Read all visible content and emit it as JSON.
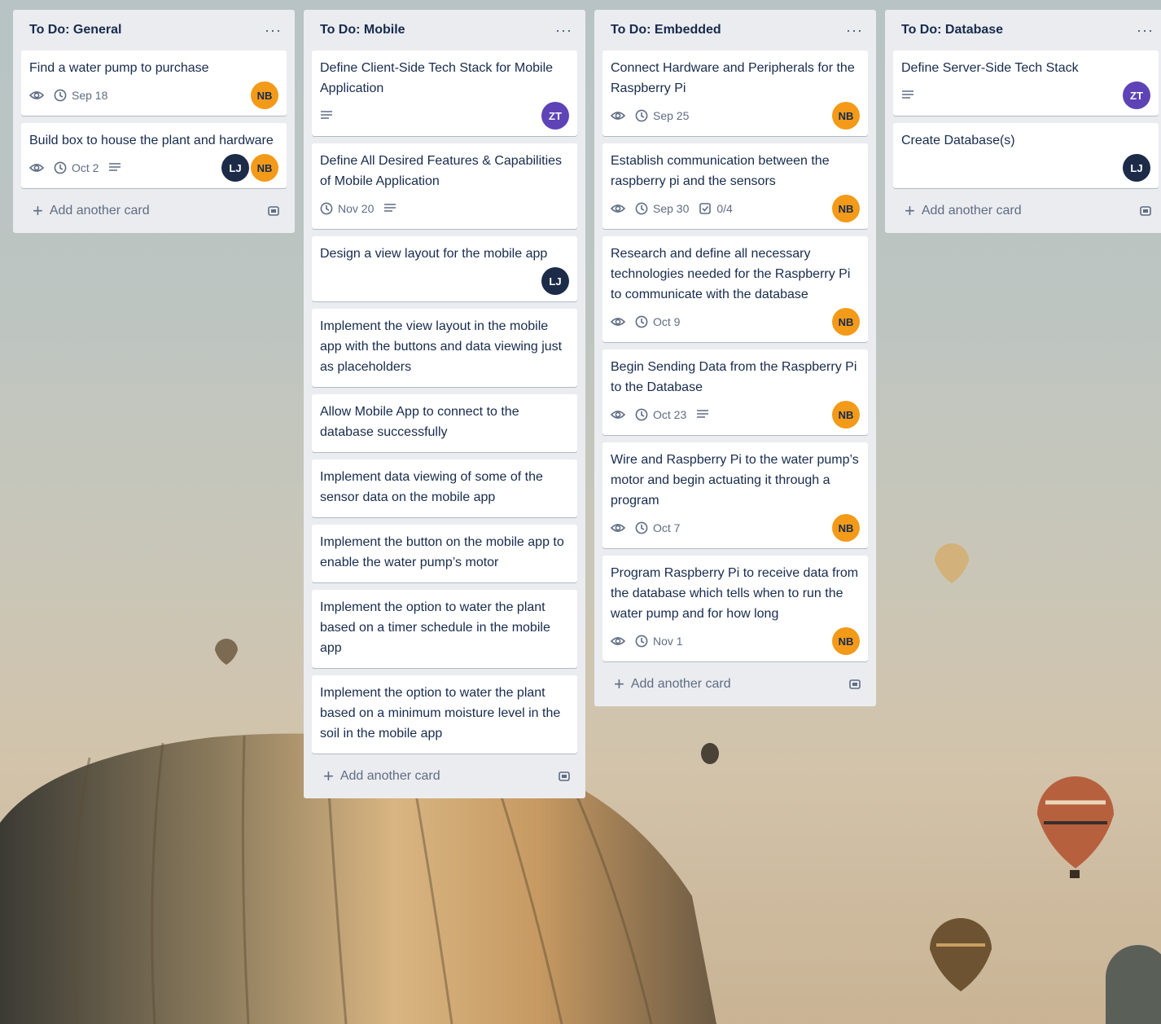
{
  "board": {
    "lists": [
      {
        "title": "To Do: General",
        "menu": "···",
        "add_label": "Add another card",
        "cards": [
          {
            "title": "Find a water pump to purchase",
            "watch": true,
            "due": "Sep 18",
            "desc": false,
            "checklist": "",
            "members": [
              "NB"
            ]
          },
          {
            "title": "Build box to house the plant and hardware",
            "watch": true,
            "due": "Oct 2",
            "desc": true,
            "checklist": "",
            "members": [
              "LJ",
              "NB"
            ]
          }
        ]
      },
      {
        "title": "To Do: Mobile",
        "menu": "···",
        "add_label": "Add another card",
        "cards": [
          {
            "title": "Define Client-Side Tech Stack for Mobile Application",
            "watch": false,
            "due": "",
            "desc": true,
            "checklist": "",
            "members": [
              "ZT"
            ]
          },
          {
            "title": "Define All Desired Features & Capabilities of Mobile Application",
            "watch": false,
            "due": "Nov 20",
            "desc": true,
            "checklist": "",
            "members": []
          },
          {
            "title": "Design a view layout for the mobile app",
            "watch": false,
            "due": "",
            "desc": false,
            "checklist": "",
            "members": [
              "LJ"
            ]
          },
          {
            "title": "Implement the view layout in the mobile app with the buttons and data viewing just as placeholders",
            "watch": false,
            "due": "",
            "desc": false,
            "checklist": "",
            "members": []
          },
          {
            "title": "Allow Mobile App to connect to the database successfully",
            "watch": false,
            "due": "",
            "desc": false,
            "checklist": "",
            "members": []
          },
          {
            "title": "Implement data viewing of some of the sensor data on the mobile app",
            "watch": false,
            "due": "",
            "desc": false,
            "checklist": "",
            "members": []
          },
          {
            "title": "Implement the button on the mobile app to enable the water pump’s motor",
            "watch": false,
            "due": "",
            "desc": false,
            "checklist": "",
            "members": []
          },
          {
            "title": "Implement the option to water the plant based on a timer schedule in the mobile app",
            "watch": false,
            "due": "",
            "desc": false,
            "checklist": "",
            "members": []
          },
          {
            "title": "Implement the option to water the plant based on a minimum moisture level in the soil in the mobile app",
            "watch": false,
            "due": "",
            "desc": false,
            "checklist": "",
            "members": []
          }
        ]
      },
      {
        "title": "To Do: Embedded",
        "menu": "···",
        "add_label": "Add another card",
        "cards": [
          {
            "title": "Connect Hardware and Peripherals for the Raspberry Pi",
            "watch": true,
            "due": "Sep 25",
            "desc": false,
            "checklist": "",
            "members": [
              "NB"
            ]
          },
          {
            "title": "Establish communication between the raspberry pi and the sensors",
            "watch": true,
            "due": "Sep 30",
            "desc": false,
            "checklist": "0/4",
            "members": [
              "NB"
            ]
          },
          {
            "title": "Research and define all necessary technologies needed for the Raspberry Pi to communicate with the database",
            "watch": true,
            "due": "Oct 9",
            "desc": false,
            "checklist": "",
            "members": [
              "NB"
            ]
          },
          {
            "title": "Begin Sending Data from the Raspberry Pi to the Database",
            "watch": true,
            "due": "Oct 23",
            "desc": true,
            "checklist": "",
            "members": [
              "NB"
            ]
          },
          {
            "title": "Wire and Raspberry Pi to the water pump’s motor and begin actuating it through a program",
            "watch": true,
            "due": "Oct 7",
            "desc": false,
            "checklist": "",
            "members": [
              "NB"
            ]
          },
          {
            "title": "Program Raspberry Pi to receive data from the database which tells when to run the water pump and for how long",
            "watch": true,
            "due": "Nov 1",
            "desc": false,
            "checklist": "",
            "members": [
              "NB"
            ]
          }
        ]
      },
      {
        "title": "To Do: Database",
        "menu": "···",
        "add_label": "Add another card",
        "cards": [
          {
            "title": "Define Server-Side Tech Stack",
            "watch": false,
            "due": "",
            "desc": true,
            "checklist": "",
            "members": [
              "ZT"
            ]
          },
          {
            "title": "Create Database(s)",
            "watch": false,
            "due": "",
            "desc": false,
            "checklist": "",
            "members": [
              "LJ"
            ]
          }
        ]
      }
    ]
  },
  "colors": {
    "list_bg": "#ebecf0",
    "card_bg": "#ffffff",
    "text": "#172b4d",
    "muted": "#5e6c84",
    "avatar_NB": "#f39a19",
    "avatar_ZT": "#5e43b6",
    "avatar_LJ": "#1c2b48"
  },
  "icons": {
    "watch": "eye-icon",
    "due": "clock-icon",
    "desc": "description-icon",
    "checklist": "checklist-icon",
    "add": "plus-icon",
    "template": "card-template-icon",
    "menu": "more-icon"
  }
}
